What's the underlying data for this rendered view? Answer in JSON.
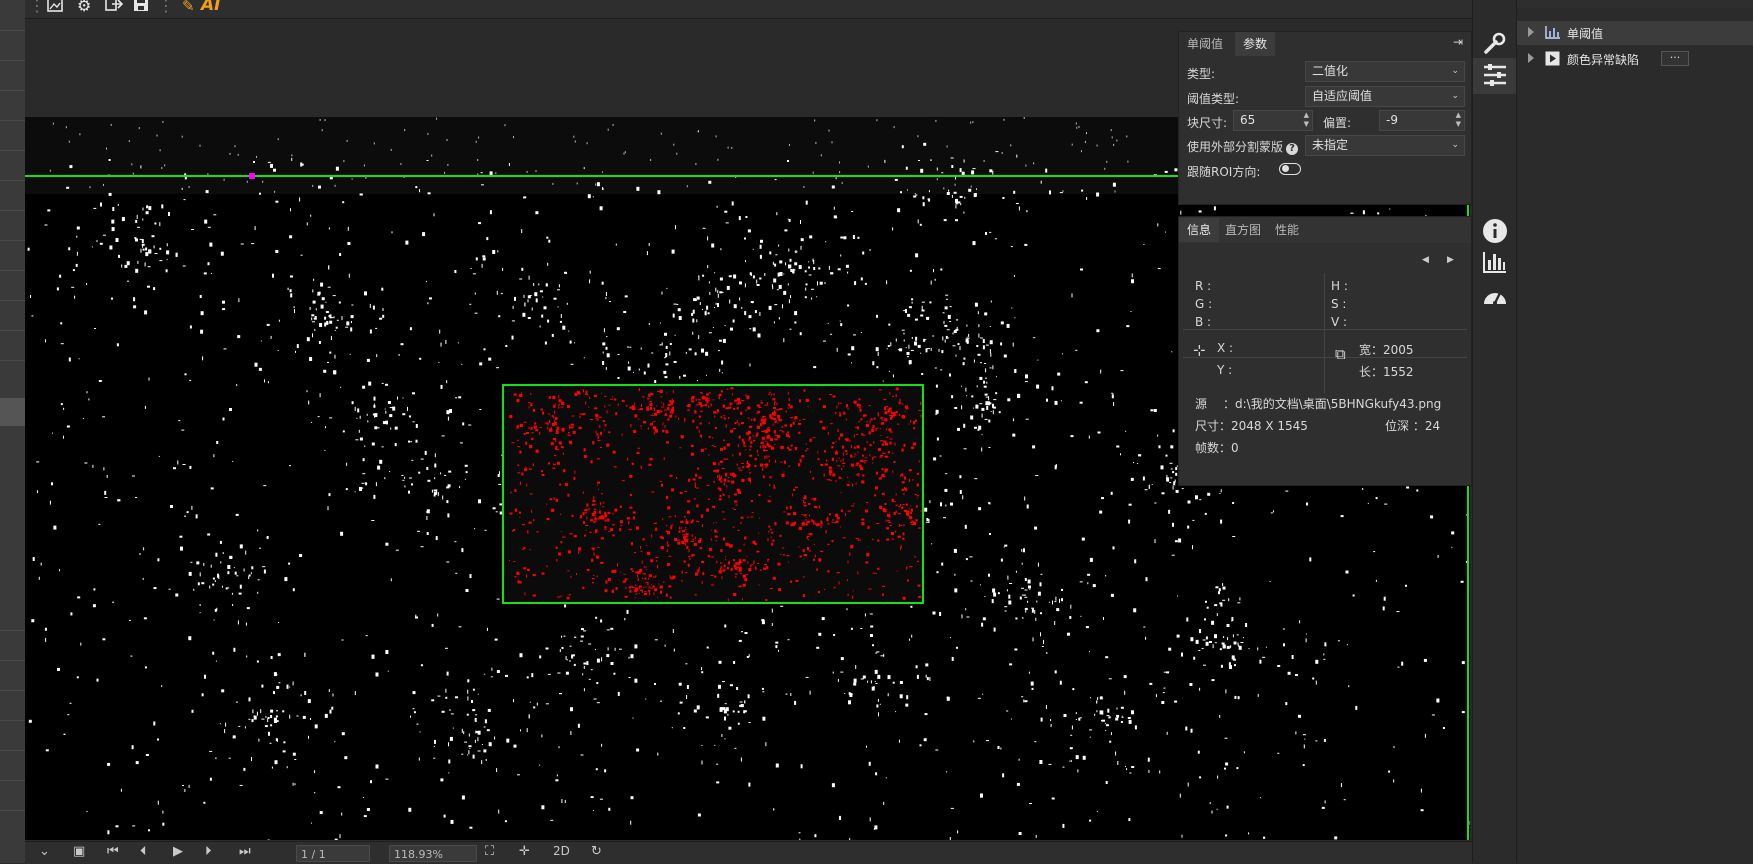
{
  "toolbar": {
    "icons": [
      "image-export-icon",
      "gear-icon",
      "export-icon",
      "save-icon",
      "ai-tool-icon"
    ],
    "ai_label": "AI"
  },
  "params_panel": {
    "tabs": [
      "单阈值",
      "参数"
    ],
    "active_tab": "参数",
    "pin_icon": "pin-icon",
    "type_label": "类型:",
    "type_value": "二值化",
    "threshold_type_label": "阈值类型:",
    "threshold_type_value": "自适应阈值",
    "block_size_label": "块尺寸:",
    "block_size_value": "65",
    "offset_label": "偏置:",
    "offset_value": "-9",
    "external_mask_label": "使用外部分割蒙版",
    "external_mask_help": "?",
    "external_mask_value": "未指定",
    "follow_roi_label": "跟随ROI方向:",
    "follow_roi_on": false
  },
  "info_panel": {
    "tabs": [
      "信息",
      "直方图",
      "性能"
    ],
    "active_tab": "信息",
    "r_label": "R :",
    "g_label": "G :",
    "b_label": "B :",
    "h_label": "H :",
    "s_label": "S :",
    "v_label": "V :",
    "x_label": "X :",
    "y_label": "Y :",
    "width_label": "宽：2005",
    "length_label": "长：1552",
    "source_label": "源",
    "source_value": "：d:\\我的文档\\桌面\\5BHNGkufy43.png",
    "size_text": "尺寸：2048 X 1545",
    "bitdepth_text": "位深 ：24",
    "frames_text": "帧数：0"
  },
  "bottom_bar": {
    "page_value": "1 / 1",
    "zoom_value": "118.93%",
    "mode_2d": "2D"
  },
  "right_icons": [
    "wrench-icon",
    "sliders-icon",
    "info-icon",
    "histogram-icon",
    "speedometer-icon"
  ],
  "tree": {
    "items": [
      {
        "label": "单阈值",
        "selected": true,
        "icon": "histogram-icon"
      },
      {
        "label": "颜色异常缺陷",
        "selected": false,
        "icon": "play-box-icon",
        "more": "···"
      }
    ]
  },
  "colors": {
    "roi_green": "#15e015",
    "defect_red": "#ff0000",
    "marker_magenta": "#ff00ff",
    "accent_orange": "#f0a020"
  }
}
